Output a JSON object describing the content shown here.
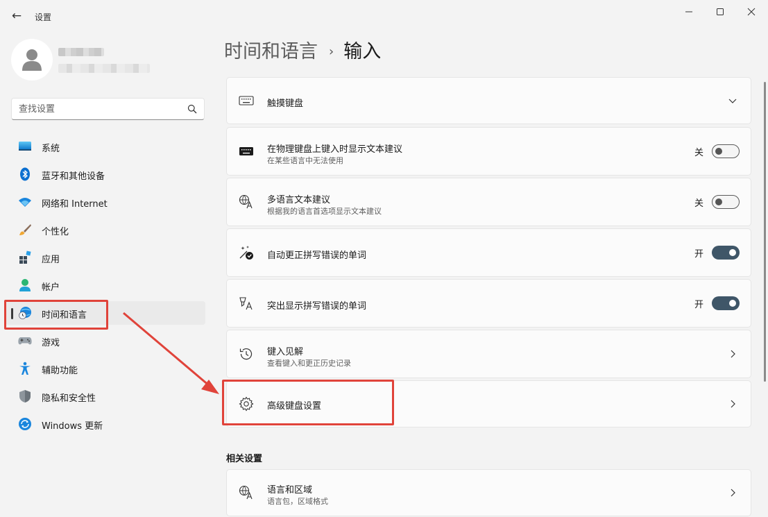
{
  "window": {
    "title": "设置",
    "back_icon": "arrow-left-icon"
  },
  "profile": {
    "avatar_icon": "person-icon"
  },
  "search": {
    "placeholder": "查找设置"
  },
  "sidebar": {
    "items": [
      {
        "label": "系统",
        "icon": "monitor-icon"
      },
      {
        "label": "蓝牙和其他设备",
        "icon": "bluetooth-icon"
      },
      {
        "label": "网络和 Internet",
        "icon": "wifi-icon"
      },
      {
        "label": "个性化",
        "icon": "brush-icon"
      },
      {
        "label": "应用",
        "icon": "apps-icon"
      },
      {
        "label": "帐户",
        "icon": "account-icon"
      },
      {
        "label": "时间和语言",
        "icon": "globe-clock-icon",
        "active": true
      },
      {
        "label": "游戏",
        "icon": "gamepad-icon"
      },
      {
        "label": "辅助功能",
        "icon": "accessibility-icon"
      },
      {
        "label": "隐私和安全性",
        "icon": "shield-icon"
      },
      {
        "label": "Windows 更新",
        "icon": "update-icon"
      }
    ]
  },
  "breadcrumb": {
    "parent": "时间和语言",
    "separator": "›",
    "current": "输入"
  },
  "settings": {
    "touch_keyboard": {
      "title": "触摸键盘"
    },
    "physical_suggestions": {
      "title": "在物理键盘上键入时显示文本建议",
      "subtitle": "在某些语言中无法使用",
      "state": "关",
      "on": false
    },
    "multilingual": {
      "title": "多语言文本建议",
      "subtitle": "根据我的语言首选项显示文本建议",
      "state": "关",
      "on": false
    },
    "autocorrect": {
      "title": "自动更正拼写错误的单词",
      "state": "开",
      "on": true
    },
    "highlight": {
      "title": "突出显示拼写错误的单词",
      "state": "开",
      "on": true
    },
    "typing_insights": {
      "title": "键入见解",
      "subtitle": "查看键入和更正历史记录"
    },
    "advanced_keyboard": {
      "title": "高级键盘设置"
    }
  },
  "related": {
    "title": "相关设置",
    "language_region": {
      "title": "语言和区域",
      "subtitle": "语言包，区域格式"
    }
  },
  "colors": {
    "annotation": "#e0433a",
    "toggle_on": "#3f5668"
  }
}
